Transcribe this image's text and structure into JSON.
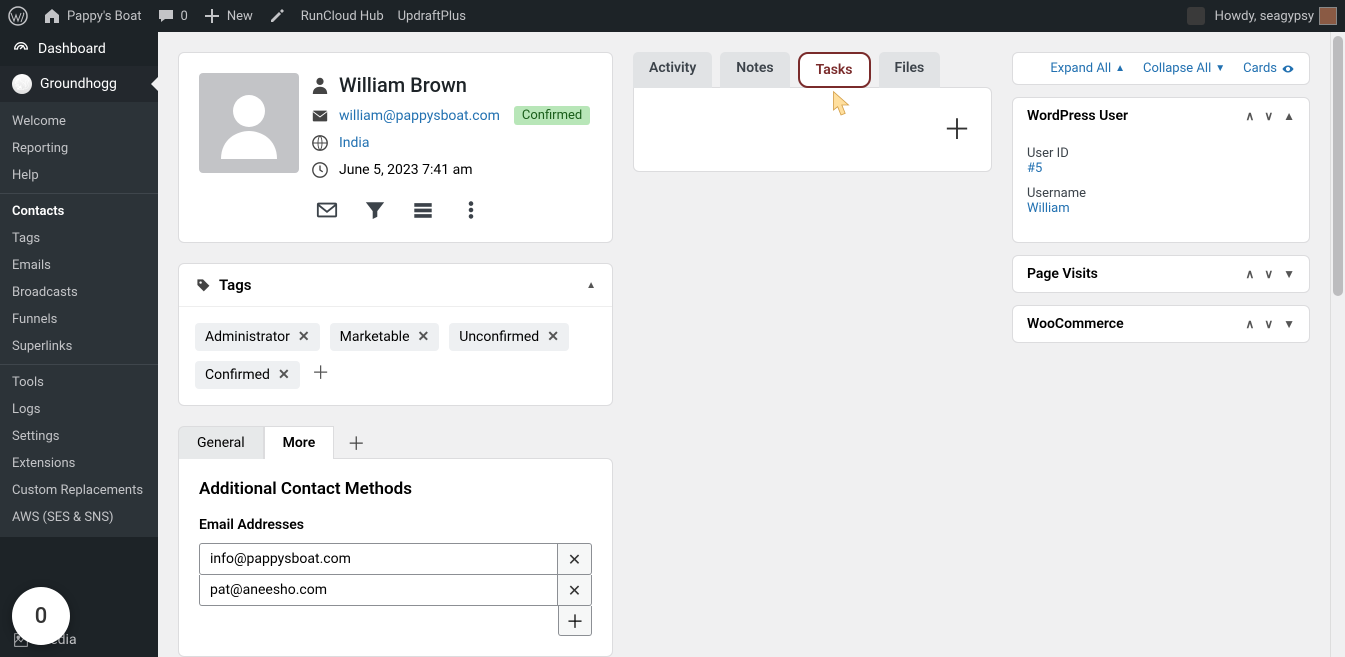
{
  "adminbar": {
    "site_name": "Pappy's Boat",
    "comments": "0",
    "new_label": "New",
    "runcloud": "RunCloud Hub",
    "updraft": "UpdraftPlus",
    "howdy": "Howdy, seagypsy"
  },
  "sidebar": {
    "dashboard": "Dashboard",
    "plugin": "Groundhogg",
    "sub": [
      "Welcome",
      "Reporting",
      "Help",
      "Contacts",
      "Tags",
      "Emails",
      "Broadcasts",
      "Funnels",
      "Superlinks",
      "Tools",
      "Logs",
      "Settings",
      "Extensions",
      "Custom Replacements",
      "AWS (SES & SNS)"
    ],
    "active_sub_index": 3,
    "media": "Media"
  },
  "contact": {
    "name": "William Brown",
    "email": "william@pappysboat.com",
    "status": "Confirmed",
    "region": "India",
    "datetime": "June 5, 2023 7:41 am"
  },
  "tags": {
    "title": "Tags",
    "items": [
      "Administrator",
      "Marketable",
      "Unconfirmed",
      "Confirmed"
    ]
  },
  "gm": {
    "tabs": [
      "General",
      "More"
    ],
    "active": 1,
    "section_title": "Additional Contact Methods",
    "emails_label": "Email Addresses",
    "emails": [
      "info@pappysboat.com",
      "pat@aneesho.com"
    ]
  },
  "mid": {
    "tabs": [
      "Activity",
      "Notes",
      "Tasks",
      "Files"
    ],
    "active": 2
  },
  "right": {
    "expand": "Expand All",
    "collapse": "Collapse All",
    "cards": "Cards",
    "panels": {
      "wp": {
        "title": "WordPress User",
        "userid_lbl": "User ID",
        "userid_val": "#5",
        "uname_lbl": "Username",
        "uname_val": "William"
      },
      "pv": {
        "title": "Page Visits"
      },
      "wc": {
        "title": "WooCommerce"
      }
    }
  },
  "help_btn": "0"
}
